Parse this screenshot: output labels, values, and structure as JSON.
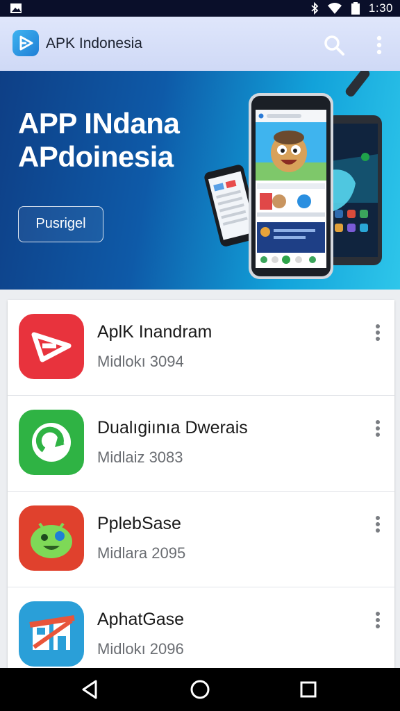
{
  "status_bar": {
    "time": "1:30",
    "icons": [
      "image-icon",
      "bluetooth-icon",
      "wifi-icon",
      "battery-icon"
    ]
  },
  "app_bar": {
    "title": "APK Indonesia",
    "icons": [
      "app-logo-icon",
      "search-icon",
      "more-vert-icon"
    ]
  },
  "banner": {
    "title_line1": "APP INdana",
    "title_line2": "APdoinesia",
    "button_label": "Pusrigel"
  },
  "apps": [
    {
      "name": "AplK Inandram",
      "subtitle": "Midlokı 3094",
      "icon": "red-play-icon",
      "color": "#e8333d"
    },
    {
      "name": "Dualıgiınıa Dwerais",
      "subtitle": "Midlaiz 3083",
      "icon": "green-refresh-icon",
      "color": "#2fb344"
    },
    {
      "name": "PplebSase",
      "subtitle": "Midlara 2095",
      "icon": "android-robot-icon",
      "color": "#e0412d"
    },
    {
      "name": "AphatGase",
      "subtitle": "Midlokı 2096",
      "icon": "blue-store-icon",
      "color": "#2a9fd8"
    }
  ],
  "nav_bar": {
    "icons": [
      "back-icon",
      "home-icon",
      "recents-icon"
    ]
  }
}
